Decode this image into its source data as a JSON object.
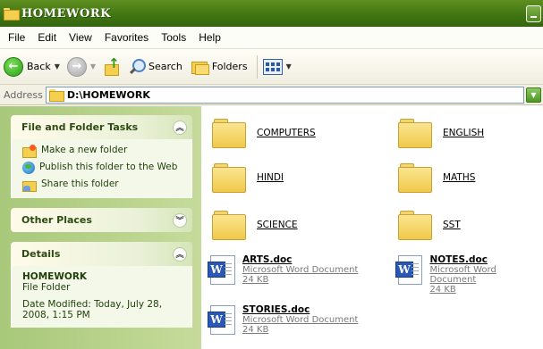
{
  "window": {
    "title": "HOMEWORK"
  },
  "menu": [
    "File",
    "Edit",
    "View",
    "Favorites",
    "Tools",
    "Help"
  ],
  "toolbar": {
    "back_label": "Back",
    "search_label": "Search",
    "folders_label": "Folders"
  },
  "address": {
    "label": "Address",
    "value": "D:\\HOMEWORK"
  },
  "sidebar": {
    "file_tasks": {
      "title": "File and Folder Tasks",
      "items": [
        "Make a new folder",
        "Publish this folder to the Web",
        "Share this folder"
      ]
    },
    "other_places": {
      "title": "Other Places"
    },
    "details": {
      "title": "Details",
      "name": "HOMEWORK",
      "type": "File Folder",
      "modified": "Date Modified: Today, July 28, 2008, 1:15 PM"
    }
  },
  "content": {
    "folders": [
      "COMPUTERS",
      "ENGLISH",
      "HINDI",
      "MATHS",
      "SCIENCE",
      "SST"
    ],
    "documents": [
      {
        "name": "ARTS.doc",
        "type": "Microsoft Word Document",
        "size": "24 KB"
      },
      {
        "name": "NOTES.doc",
        "type": "Microsoft Word Document",
        "size": "24 KB"
      },
      {
        "name": "STORIES.doc",
        "type": "Microsoft Word Document",
        "size": "24 KB"
      }
    ]
  },
  "colors": {
    "titlebar": "#3f7412",
    "sidebar": "#b5d089",
    "folder": "#f5cf50",
    "word": "#2b57b5"
  }
}
